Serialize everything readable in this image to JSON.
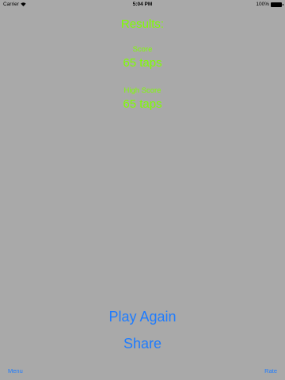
{
  "status_bar": {
    "carrier": "Carrier",
    "time": "5:04 PM",
    "battery_percent": "100%",
    "battery_level": 1.0,
    "icons": [
      "wifi-icon",
      "battery-icon"
    ]
  },
  "results": {
    "title": "Results:",
    "score_label": "Score",
    "score_value": "65 taps",
    "high_score_label": "High Score",
    "high_score_value": "65 taps"
  },
  "actions": {
    "play_again": "Play Again",
    "share": "Share"
  },
  "footer": {
    "menu": "Menu",
    "rate": "Rate"
  },
  "colors": {
    "background": "#a9a9a9",
    "results_text": "#7fff00",
    "link": "#1e7cff"
  }
}
